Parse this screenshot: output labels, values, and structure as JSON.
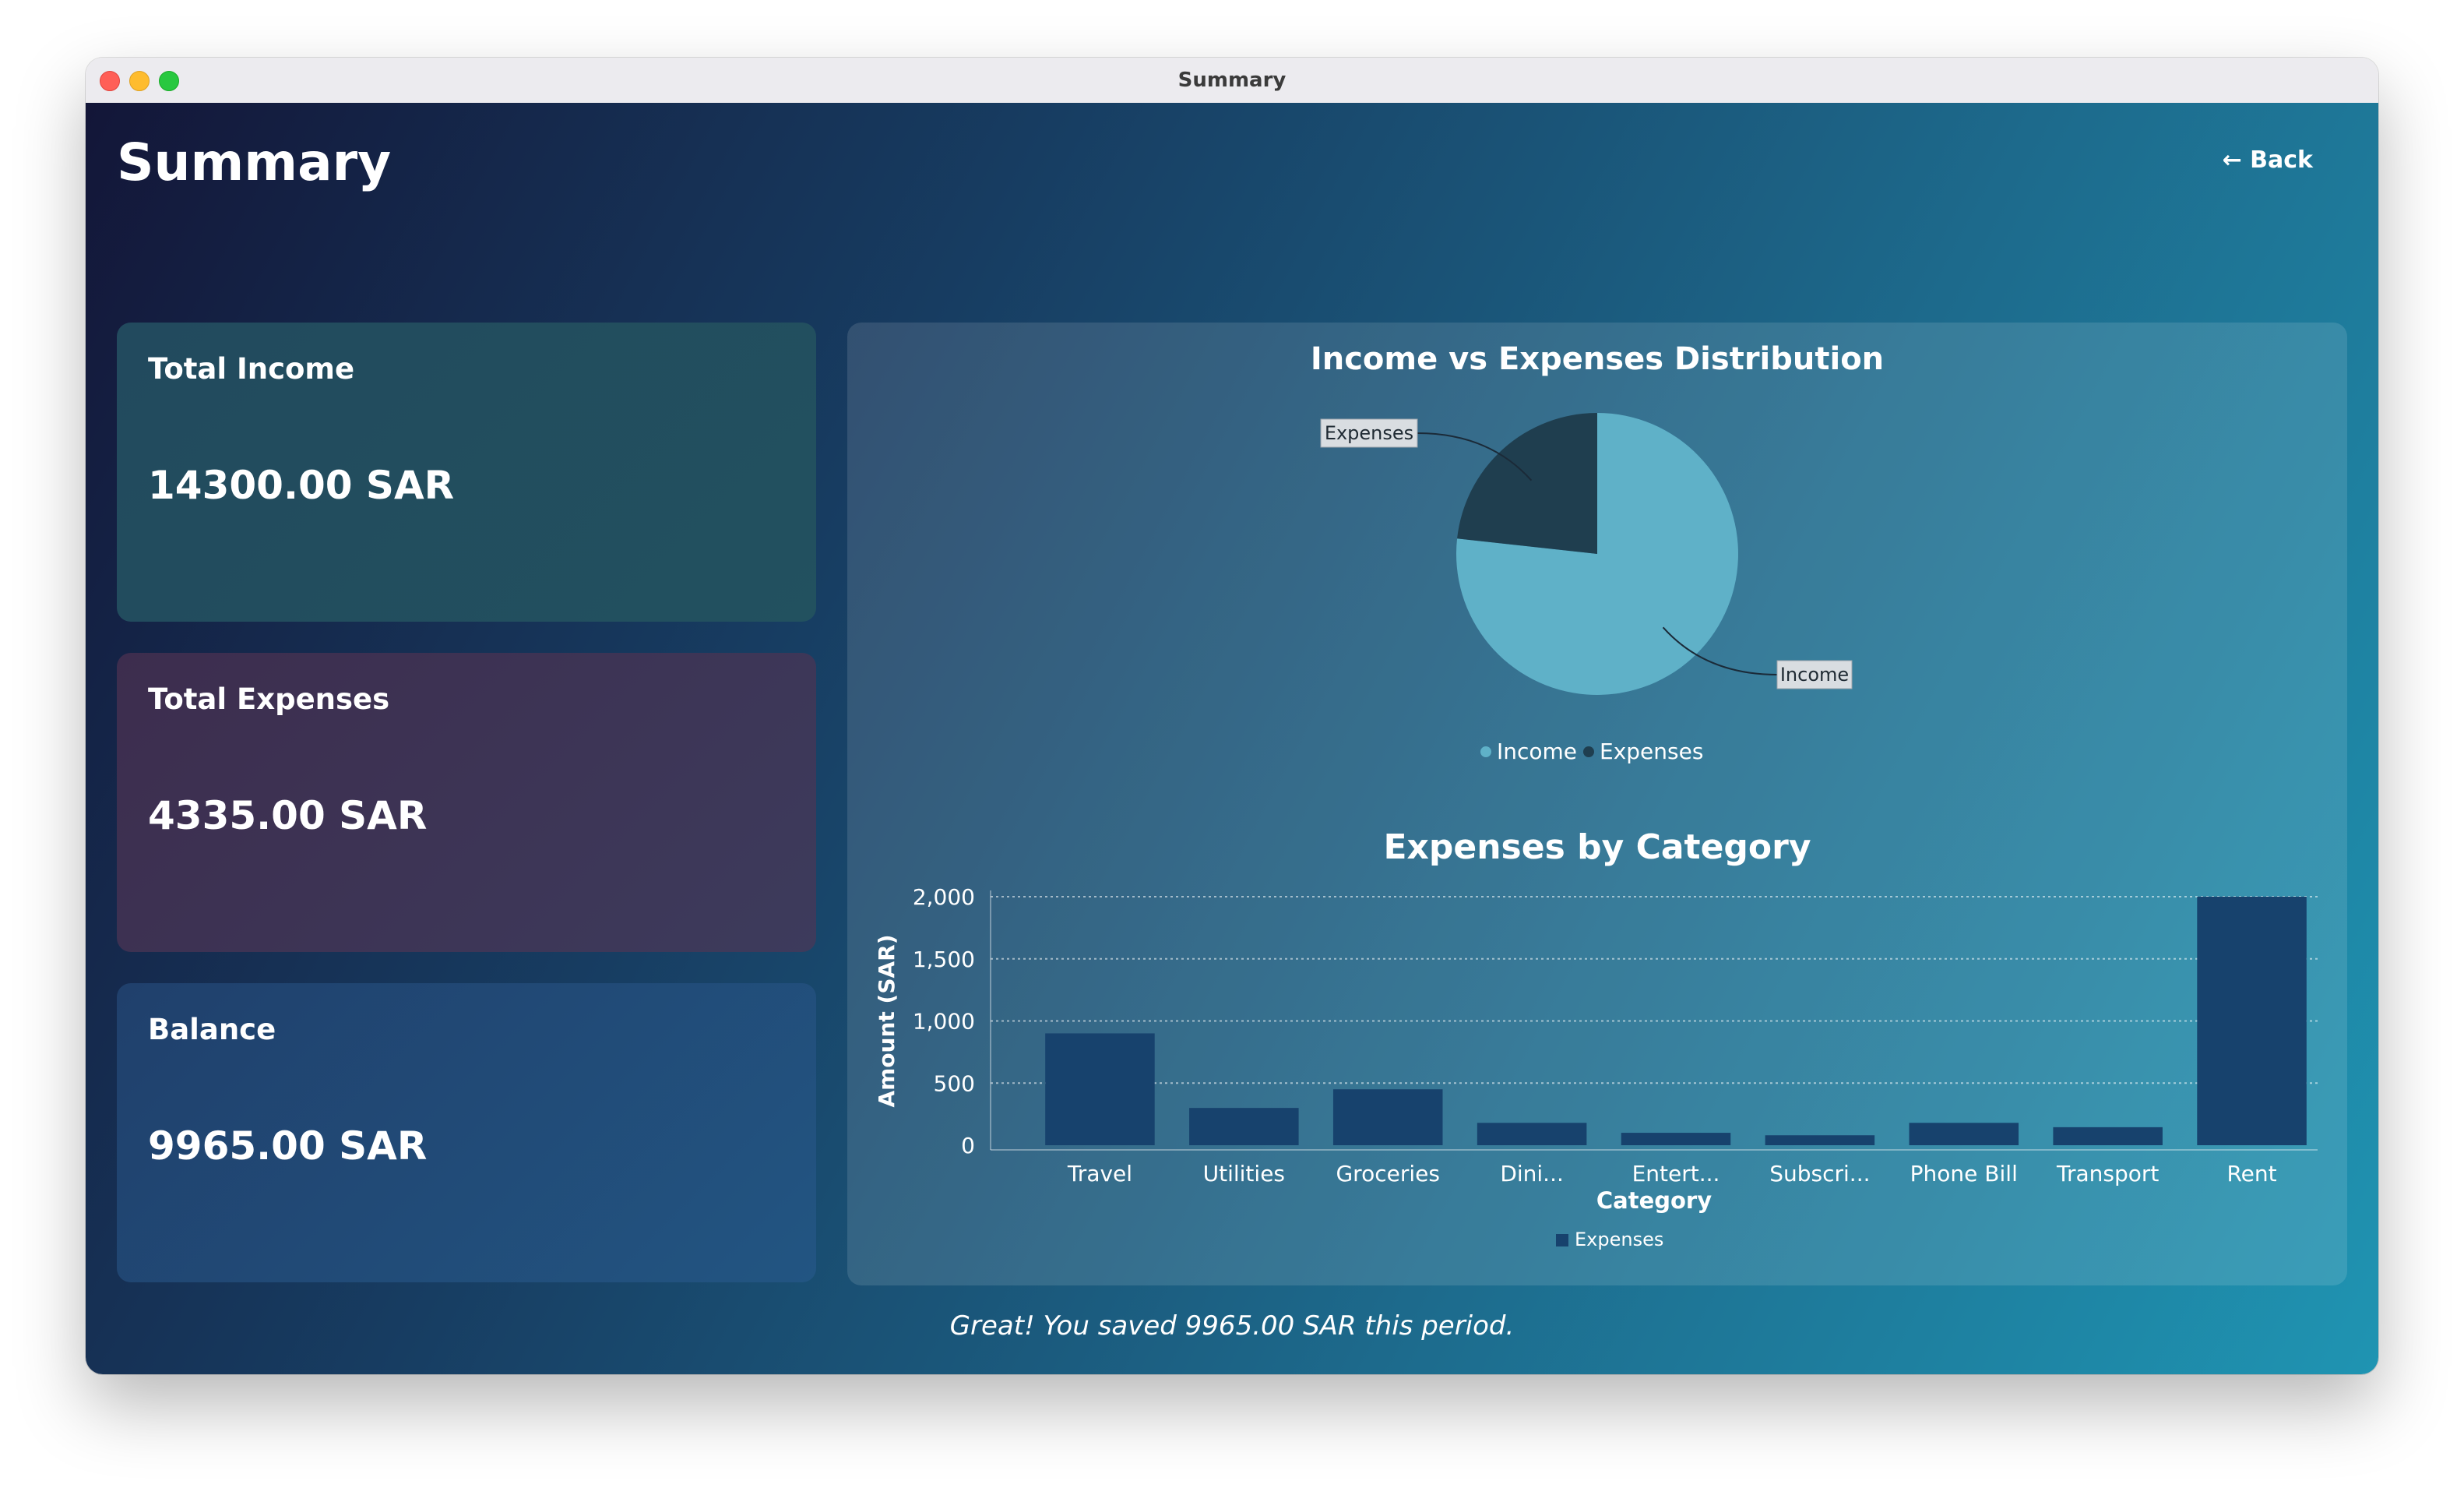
{
  "window": {
    "title": "Summary"
  },
  "header": {
    "title": "Summary",
    "back_label": "← Back"
  },
  "cards": {
    "income": {
      "label": "Total Income",
      "value": "14300.00 SAR",
      "color": "#22515f"
    },
    "expenses": {
      "label": "Total Expenses",
      "value": "4335.00 SAR",
      "color": "#3d3b5c"
    },
    "balance": {
      "label": "Balance",
      "value": "9965.00 SAR",
      "color": "#225582"
    }
  },
  "footer": {
    "message": "Great! You saved 9965.00 SAR this period."
  },
  "colors": {
    "income_slice": "#5fb1c8",
    "expenses_slice": "#1f3e4f",
    "bar": "#17426d"
  },
  "chart_data": [
    {
      "type": "pie",
      "title": "Income vs Expenses Distribution",
      "slices": [
        {
          "label": "Income",
          "value": 14300,
          "color": "#5fb1c8"
        },
        {
          "label": "Expenses",
          "value": 4335,
          "color": "#1f3e4f"
        }
      ],
      "legend": [
        "Income",
        "Expenses"
      ],
      "legend_position": "bottom"
    },
    {
      "type": "bar",
      "title": "Expenses by Category",
      "xlabel": "Category",
      "ylabel": "Amount (SAR)",
      "categories": [
        "Travel",
        "Utilities",
        "Groceries",
        "Dini...",
        "Entert...",
        "Subscri...",
        "Phone Bill",
        "Transport",
        "Rent"
      ],
      "series": [
        {
          "name": "Expenses",
          "values": [
            900,
            300,
            450,
            180,
            100,
            80,
            180,
            145,
            2000
          ],
          "color": "#17426d"
        }
      ],
      "ylim": [
        0,
        2000
      ],
      "yticks": [
        "0",
        "500",
        "1,000",
        "1,500",
        "2,000"
      ],
      "grid": true,
      "legend_position": "bottom"
    }
  ]
}
